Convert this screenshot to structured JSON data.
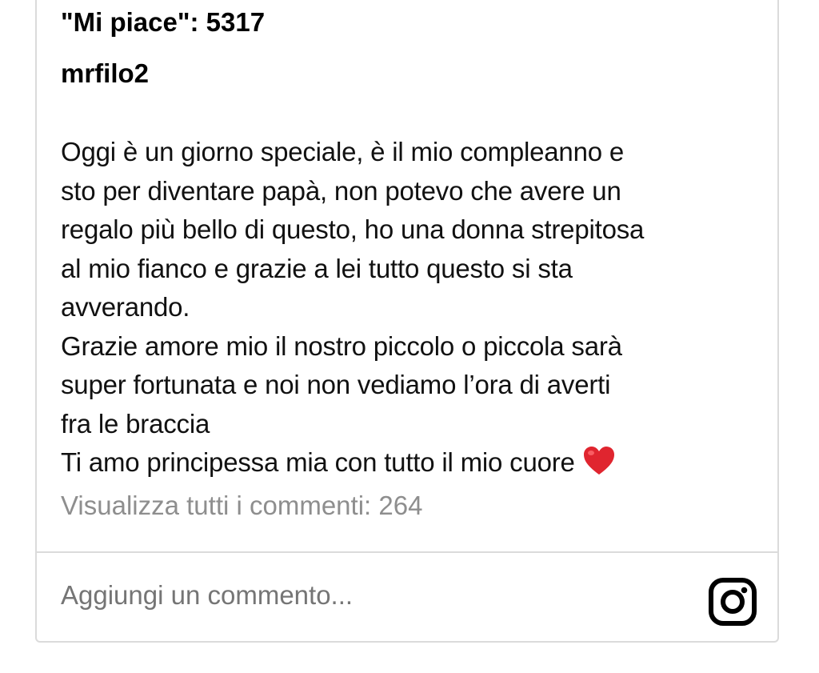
{
  "post": {
    "likes_text": "\"Mi piace\": 5317",
    "username": "mrfilo2",
    "caption_lines": [
      "Oggi è un giorno speciale, è il mio compleanno e",
      "sto per diventare papà, non potevo che avere un",
      "regalo più bello di questo, ho una donna strepitosa",
      "al mio fianco e grazie a lei tutto questo si sta",
      "avverando.",
      "Grazie amore mio il nostro piccolo o piccola sarà",
      "super fortunata e noi non vediamo l’ora di averti",
      "fra le braccia",
      "Ti amo principessa mia con tutto il mio cuore"
    ],
    "view_comments_text": "Visualizza tutti i commenti: 264"
  },
  "comment_box": {
    "placeholder": "Aggiungi un commento..."
  },
  "icons": {
    "heart": "red-heart-emoji",
    "instagram": "instagram-icon"
  },
  "colors": {
    "border": "#dbdbdb",
    "muted_text": "#8e8e8e",
    "heart": "#e0252f"
  }
}
